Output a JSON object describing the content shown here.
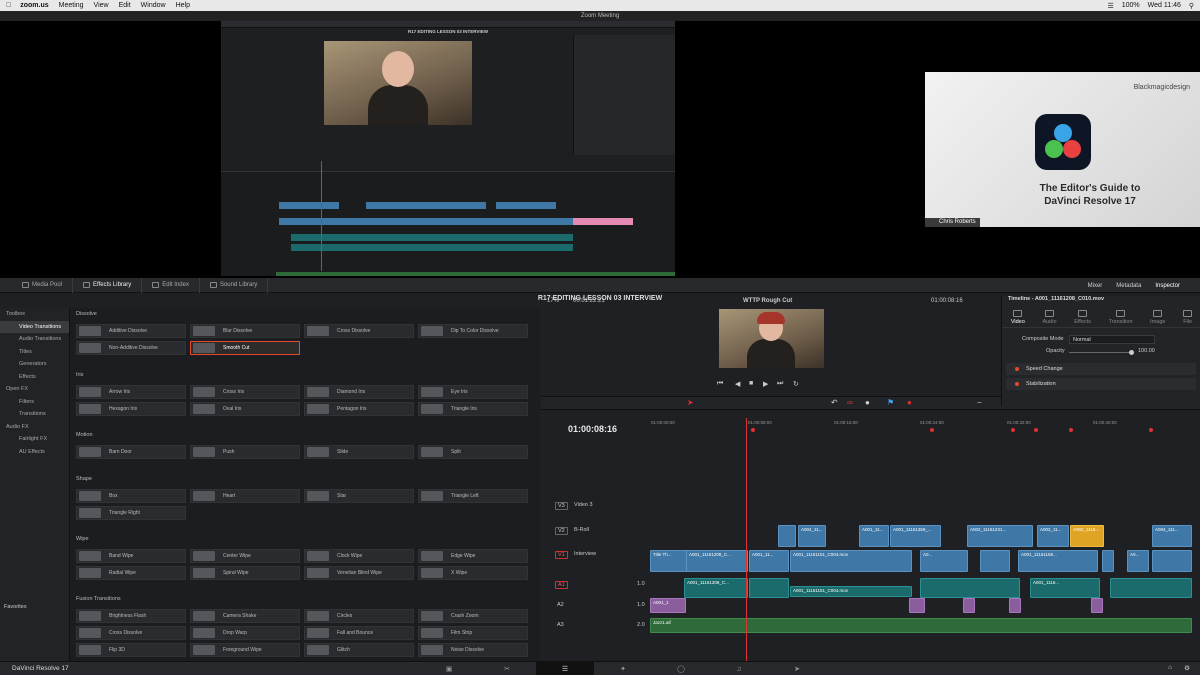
{
  "menubar": {
    "app": "zoom.us",
    "menus": [
      "Meeting",
      "View",
      "Edit",
      "Window",
      "Help"
    ],
    "battery": "100%",
    "clock": "Wed 11:46"
  },
  "zoom": {
    "window_title": "Zoom Meeting"
  },
  "shared": {
    "title": "R17 EDITING LESSON 03 INTERVIEW"
  },
  "webcam": {
    "brand": "Blackmagicdesign",
    "title_line1": "The Editor's Guide to",
    "title_line2": "DaVinci Resolve 17",
    "participant": "Chris Roberts"
  },
  "resolve": {
    "tabs": {
      "media_pool": "Media Pool",
      "effects_library": "Effects Library",
      "edit_index": "Edit Index",
      "sound_library": "Sound Library"
    },
    "right_tabs": {
      "mixer": "Mixer",
      "metadata": "Metadata",
      "inspector": "Inspector"
    },
    "project_title": "R17 EDITING LESSON 03 INTERVIEW",
    "sidebar": {
      "toolbox": "Toolbox",
      "video_transitions": "Video Transitions",
      "audio_transitions": "Audio Transitions",
      "titles": "Titles",
      "generators": "Generators",
      "effects": "Effects",
      "open_fx": "Open FX",
      "filters": "Filters",
      "transitions": "Transitions",
      "audio_fx": "Audio FX",
      "fairlight_fx": "Fairlight FX",
      "au_effects": "AU Effects",
      "favorites": "Favorites"
    },
    "library": {
      "dissolve": {
        "title": "Dissolve",
        "items": [
          "Additive Dissolve",
          "Blur Dissolve",
          "Cross Dissolve",
          "Dip To Color Dissolve",
          "Non-Additive Dissolve",
          "Smooth Cut"
        ]
      },
      "iris": {
        "title": "Iris",
        "items": [
          "Arrow Iris",
          "Cross Iris",
          "Diamond Iris",
          "Eye Iris",
          "Hexagon Iris",
          "Oval Iris",
          "Pentagon Iris",
          "Triangle Iris"
        ]
      },
      "motion": {
        "title": "Motion",
        "items": [
          "Barn Door",
          "Push",
          "Slide",
          "Split"
        ]
      },
      "shape": {
        "title": "Shape",
        "items": [
          "Box",
          "Heart",
          "Star",
          "Triangle Left",
          "Triangle Right"
        ]
      },
      "wipe": {
        "title": "Wipe",
        "items": [
          "Band Wipe",
          "Center Wipe",
          "Clock Wipe",
          "Edge Wipe",
          "Radial Wipe",
          "Spiral Wipe",
          "Venetian Blind Wipe",
          "X Wipe"
        ]
      },
      "fusion": {
        "title": "Fusion Transitions",
        "items": [
          "Brightness Flash",
          "Camera Shake",
          "Circles",
          "Crash Zoom",
          "Cross Dissolve",
          "Drop Warp",
          "Fall and Bounce",
          "Film Strip",
          "Flip 3D",
          "Foreground Wipe",
          "Glitch",
          "Noise Dissolve"
        ]
      }
    },
    "viewer": {
      "zoom": "17%",
      "src_tc": "00:01:22:21",
      "timeline_name": "WTTP Rough Cut",
      "rec_tc": "01:00:08:16"
    },
    "timeline": {
      "timecode": "01:00:08:16",
      "ruler": [
        "01:00:00:00",
        "01:00:08:00",
        "01:00:16:00",
        "01:00:24:00",
        "01:00:32:00",
        "01:00:40:00"
      ],
      "tracks": {
        "v3": {
          "id": "V3",
          "name": "Video 3"
        },
        "v2": {
          "id": "V2",
          "name": "B-Roll"
        },
        "v1": {
          "id": "V1",
          "name": "Interview"
        },
        "a1": {
          "id": "A1",
          "level": "1.0"
        },
        "a2": {
          "id": "A2",
          "level": "1.0"
        },
        "a3": {
          "id": "A3",
          "level": "2.0"
        }
      },
      "clips": {
        "b1": "A004_11...",
        "b2": "A001_11...",
        "b3": "A001_11161359_...",
        "b4": "A002_11161231...",
        "b5": "A002_11...",
        "b6": "A002_1116...",
        "b7": "A004_111...",
        "v1": "Title Th...",
        "v2": "A001_11161208_C...",
        "v3": "A001_11...",
        "v4": "A001_11161151_C004.mov",
        "v5": "A0...",
        "v6": "A001_11161158...",
        "v7": "A0...",
        "a1": "A001_11161208_C...",
        "a2": "A001_11161151_C004.mov",
        "a3": "A001_1116...",
        "m1": "A001_1",
        "music": "Jazz1.aif"
      }
    },
    "inspector": {
      "title": "Timeline - A001_11161208_C010.mov",
      "tabs": [
        "Video",
        "Audio",
        "Effects",
        "Transition",
        "Image",
        "File"
      ],
      "composite_label": "Composite Mode",
      "composite_value": "Normal",
      "opacity_label": "Opacity",
      "opacity_value": "100.00",
      "speed_change": "Speed Change",
      "stabilization": "Stabilization"
    },
    "bottombar": {
      "app_name": "DaVinci Resolve 17"
    }
  }
}
